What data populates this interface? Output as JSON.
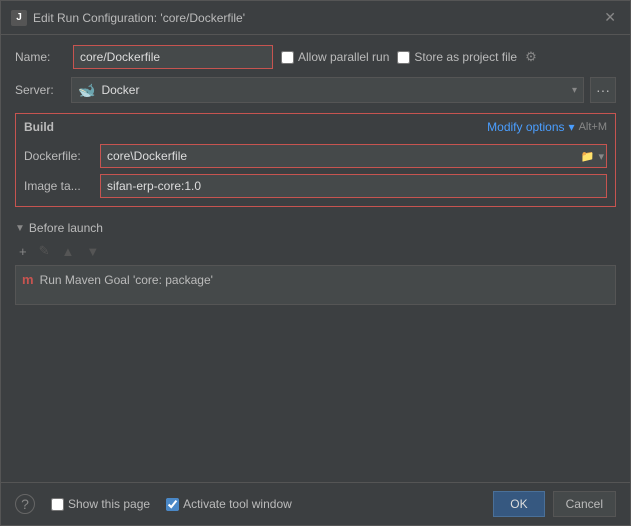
{
  "titleBar": {
    "title": "Edit Run Configuration: 'core/Dockerfile'",
    "appIconLabel": "J",
    "closeLabel": "✕"
  },
  "nameRow": {
    "label": "Name:",
    "value": "core/Dockerfile",
    "allowParallelLabel": "Allow parallel run",
    "storeAsProjectLabel": "Store as project file"
  },
  "serverRow": {
    "label": "Server:",
    "serverName": "Docker",
    "moreLabel": "···"
  },
  "buildSection": {
    "label": "Build",
    "modifyOptionsLabel": "Modify options",
    "modifyArrow": "▾",
    "shortcut": "Alt+M",
    "dockerfileLabel": "Dockerfile:",
    "dockerfileValue": "core\\Dockerfile",
    "imageTagLabel": "Image ta...",
    "imageTagValue": "sifan-erp-core:1.0",
    "folderIconLabel": "📁",
    "dropdownIconLabel": "▾"
  },
  "beforeLaunch": {
    "label": "Before launch",
    "addLabel": "+",
    "editLabel": "✎",
    "upLabel": "▲",
    "downLabel": "▼",
    "mavenLabel": "m",
    "mavenTask": "Run Maven Goal 'core: package'"
  },
  "bottomBar": {
    "helpLabel": "?",
    "showPageLabel": "Show this page",
    "activateToolLabel": "Activate tool window",
    "okLabel": "OK",
    "cancelLabel": "Cancel"
  }
}
